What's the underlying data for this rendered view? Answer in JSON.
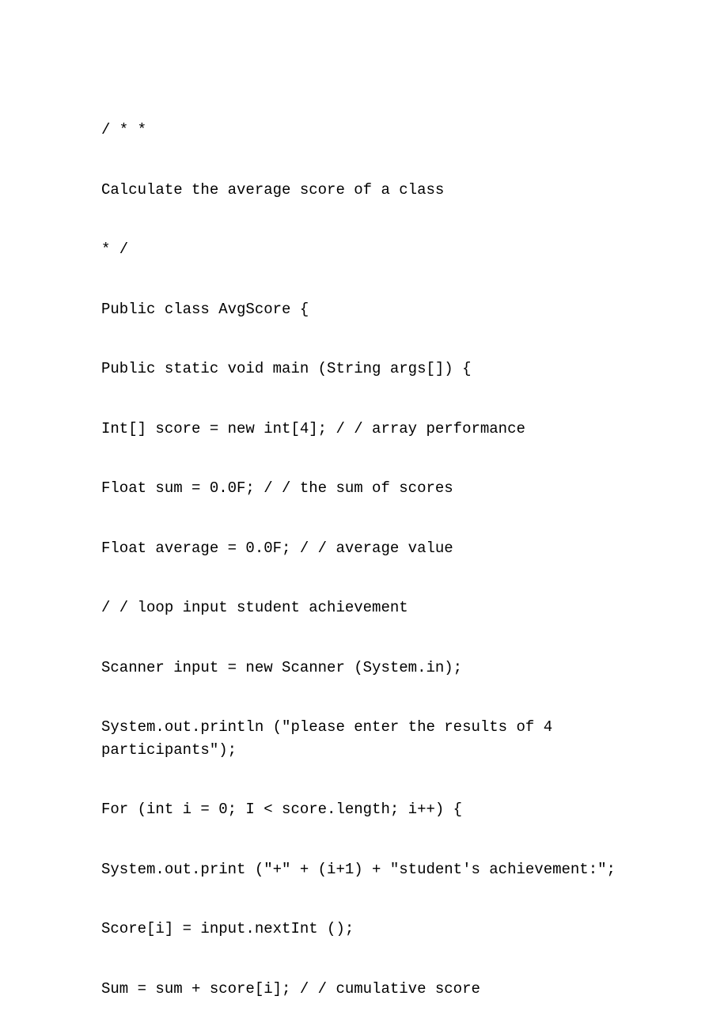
{
  "code": {
    "line1": "/ * *",
    "line2": "Calculate the average score of a class",
    "line3": "* /",
    "line4": "Public class AvgScore {",
    "line5": "Public static void main (String args[]) {",
    "line6": "Int[] score = new int[4]; / / array performance",
    "line7": "Float sum = 0.0F; / / the sum of scores",
    "line8": "Float average = 0.0F; / / average value",
    "line9": "/ / loop input student achievement",
    "line10": "Scanner input = new Scanner (System.in);",
    "line11a": "System.out.println (\"please enter the results of 4 ",
    "line11b": "participants\");",
    "line12": "For (int i = 0; I < score.length; i++) {",
    "line13": "System.out.print (\"+\" + (i+1) + \"student's achievement:\";",
    "line14": "Score[i] = input.nextInt ();",
    "line15": "Sum = sum + score[i]; / / cumulative score"
  }
}
